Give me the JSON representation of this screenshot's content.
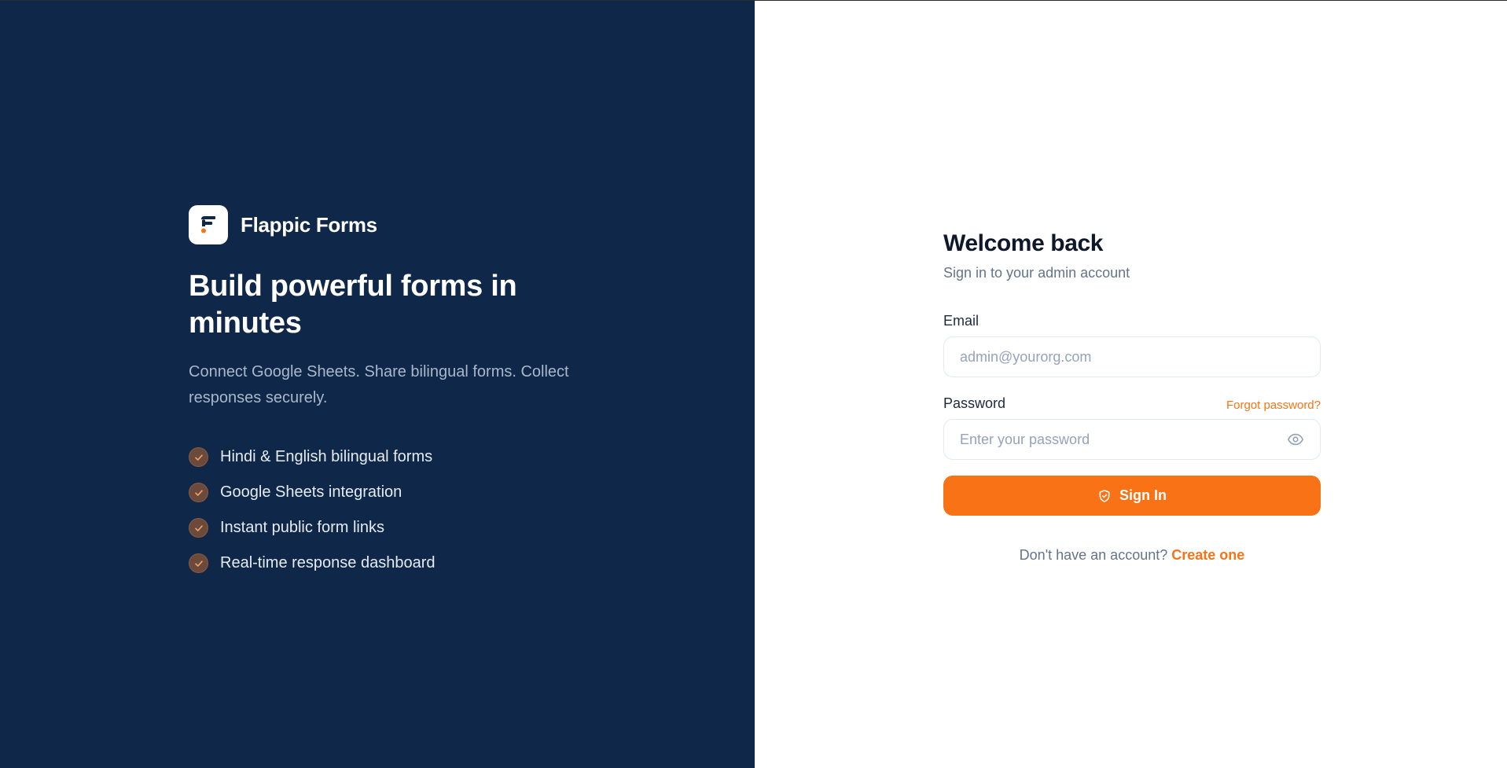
{
  "brand": {
    "name": "Flappic Forms",
    "logo_icon": "flappic-f-logo-icon"
  },
  "hero": {
    "headline": "Build powerful forms in minutes",
    "tagline": "Connect Google Sheets. Share bilingual forms. Collect responses securely.",
    "features": [
      {
        "label": "Hindi & English bilingual forms",
        "icon": "check-circle-icon"
      },
      {
        "label": "Google Sheets integration",
        "icon": "check-circle-icon"
      },
      {
        "label": "Instant public form links",
        "icon": "check-circle-icon"
      },
      {
        "label": "Real-time response dashboard",
        "icon": "check-circle-icon"
      }
    ]
  },
  "login": {
    "title": "Welcome back",
    "subtitle": "Sign in to your admin account",
    "email": {
      "label": "Email",
      "value": "",
      "placeholder": "admin@yourorg.com"
    },
    "password": {
      "label": "Password",
      "value": "",
      "placeholder": "Enter your password",
      "forgot_link": "Forgot password?",
      "toggle_icon": "eye-icon"
    },
    "submit": {
      "label": "Sign In",
      "icon": "shield-check-icon"
    },
    "footer": {
      "prompt": "Don't have an account?",
      "link": "Create one"
    }
  },
  "colors": {
    "left_panel_bg": "#0f2849",
    "accent": "#f97316",
    "heading": "#0f172a",
    "muted_text": "#64748b",
    "input_border": "#e2e8f0"
  }
}
